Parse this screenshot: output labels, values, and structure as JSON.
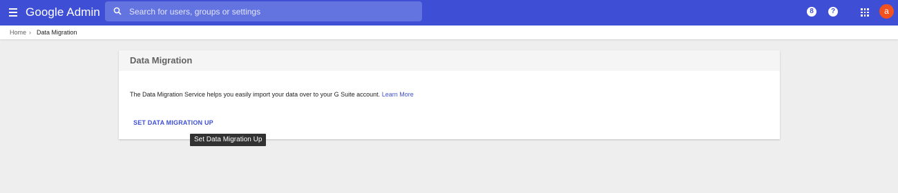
{
  "header": {
    "title": "Google Admin",
    "search_placeholder": "Search for users, groups or settings",
    "support_icon_glyph": "8",
    "help_icon_glyph": "?",
    "avatar_letter": "a",
    "bar_color": "#3e4fd6",
    "avatar_color": "#f4511e"
  },
  "breadcrumb": {
    "home": "Home",
    "separator": "›",
    "current": "Data Migration"
  },
  "card": {
    "title": "Data Migration",
    "description": "The Data Migration Service helps you easily import your data over to your G Suite account.",
    "learn_more": "Learn More",
    "action_label": "SET DATA MIGRATION UP"
  },
  "tooltip": {
    "text": "Set Data Migration Up"
  }
}
